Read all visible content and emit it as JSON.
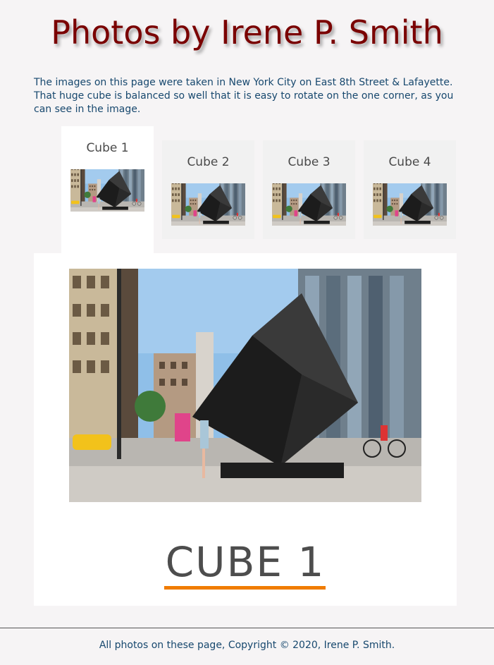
{
  "header": {
    "title": "Photos by Irene P. Smith"
  },
  "intro": {
    "text": "The images on this page were taken in New York City on East 8th Street & Lafayette. That huge cube is balanced so well that it is easy to rotate on the one corner, as you can see in the image."
  },
  "tabs": [
    {
      "label": "Cube 1",
      "active": true
    },
    {
      "label": "Cube 2",
      "active": false
    },
    {
      "label": "Cube 3",
      "active": false
    },
    {
      "label": "Cube 4",
      "active": false
    }
  ],
  "panel": {
    "caption": "CUBE 1"
  },
  "colors": {
    "title": "#7a0000",
    "text": "#17486e",
    "accent": "#f07c00",
    "caption": "#4d4d4d"
  },
  "footer": {
    "text": "All photos on these page, Copyright © 2020, Irene P. Smith."
  }
}
